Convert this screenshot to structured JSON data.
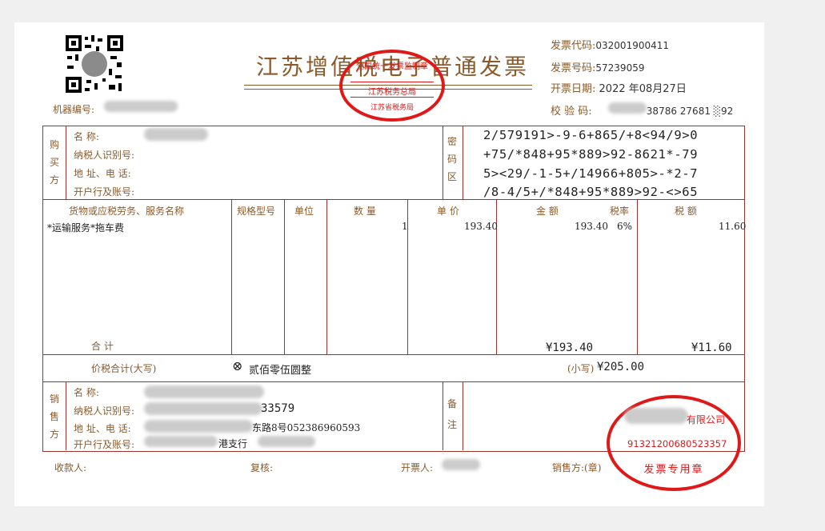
{
  "invoice": {
    "title": "江苏增值税电子普通发票",
    "meta": {
      "code_label": "发票代码:",
      "code_value": "032001900411",
      "number_label": "发票号码:",
      "number_value": "57239059",
      "date_label": "开票日期:",
      "date_value": "2022 年08月27日",
      "check_label": "校 验 码:",
      "check_value": "38786 27681 ░92"
    },
    "machine_label": "机器编号:",
    "buyer": {
      "section_label": "购买方",
      "name_label": "名            称:",
      "taxid_label": "纳税人识别号:",
      "address_label": "地  址、电  话:",
      "bank_label": "开户行及账号:"
    },
    "cipher": {
      "section_label": "密码区",
      "lines": [
        "2/579191>-9-6+865/+8<94/9>0",
        "+75/*848+95*889>92-8621*-79",
        "5><29/-1-5+/14966+805>-*2-7",
        "/8-4/5+/*848+95*889>92-<>65"
      ]
    },
    "columns": {
      "name": "货物或应税劳务、服务名称",
      "spec": "规格型号",
      "unit": "单位",
      "qty": "数 量",
      "price": "单 价",
      "amount": "金  额",
      "rate": "税率",
      "tax": "税  额"
    },
    "items": [
      {
        "name": "*运输服务*拖车费",
        "qty": "1",
        "price": "193.40",
        "amount": "193.40",
        "rate": "6%",
        "tax": "11.60"
      }
    ],
    "total_label": "合      计",
    "total_amount": "¥193.40",
    "total_tax": "¥11.60",
    "grand_label": "价税合计(大写)",
    "grand_icon_glyph": "⊗",
    "grand_words": "贰佰零伍圆整",
    "grand_small_label": "(小写)",
    "grand_small": "¥205.00",
    "seller": {
      "section_label": "销售方",
      "name_label": "名            称:",
      "taxid_label": "纳税人识别号:",
      "taxid_tail": "33579",
      "address_label": "地  址、电  话:",
      "address_tail": "东路8号052386960593",
      "bank_label": "开户行及账号:",
      "bank_tail": "港支行"
    },
    "remark_label": "备注",
    "footer": {
      "payee_label": "收款人:",
      "reviewer_label": "复核:",
      "issuer_label": "开票人:",
      "seller_label": "销售方:(章)"
    },
    "stamp_top": {
      "outer_text": "全国统一发票监制章",
      "middle_text": "江苏税务总局",
      "bottom_text": "江苏省税务局"
    },
    "stamp_seller": {
      "company_tail": "有限公司",
      "taxid": "91321200680523357",
      "label": "发票专用章"
    }
  },
  "colors": {
    "frame": "#a0302a",
    "label": "#8a5a2b",
    "stamp": "#e01818"
  }
}
